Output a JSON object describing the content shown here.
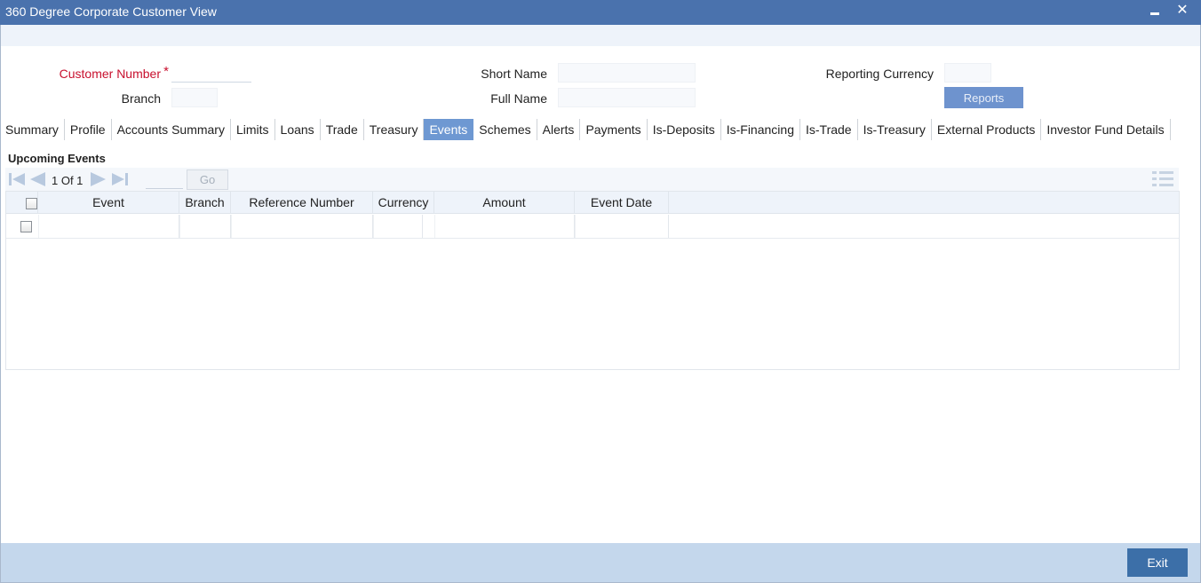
{
  "window": {
    "title": "360 Degree Corporate Customer View",
    "minimize": "minimize",
    "close": "✕"
  },
  "header": {
    "customer_number_label": "Customer Number",
    "required_mark": "*",
    "branch_label": "Branch",
    "short_name_label": "Short Name",
    "full_name_label": "Full Name",
    "reporting_currency_label": "Reporting Currency",
    "reports_button": "Reports"
  },
  "tabs": [
    {
      "label": "Summary"
    },
    {
      "label": "Profile"
    },
    {
      "label": "Accounts Summary"
    },
    {
      "label": "Limits"
    },
    {
      "label": "Loans"
    },
    {
      "label": "Trade"
    },
    {
      "label": "Treasury"
    },
    {
      "label": "Events"
    },
    {
      "label": "Schemes"
    },
    {
      "label": "Alerts"
    },
    {
      "label": "Payments"
    },
    {
      "label": "Is-Deposits"
    },
    {
      "label": "Is-Financing"
    },
    {
      "label": "Is-Trade"
    },
    {
      "label": "Is-Treasury"
    },
    {
      "label": "External Products"
    },
    {
      "label": "Investor Fund Details"
    }
  ],
  "active_tab": "Events",
  "section": {
    "title": "Upcoming Events"
  },
  "pager": {
    "text": "1 Of 1",
    "go_label": "Go"
  },
  "grid": {
    "columns": [
      "Event",
      "Branch",
      "Reference Number",
      "Currency",
      "Amount",
      "Event Date"
    ]
  },
  "footer": {
    "exit_label": "Exit"
  },
  "colors": {
    "titlebar": "#4a72ad",
    "active_tab": "#6e98d2",
    "required": "#c8102e",
    "footer": "#c4d7ec",
    "exit_button": "#3c6fa8"
  }
}
